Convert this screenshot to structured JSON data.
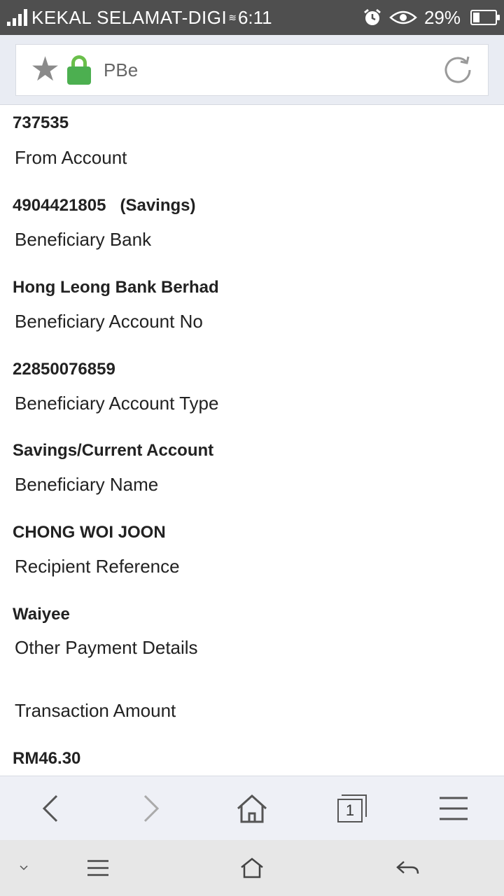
{
  "status_bar": {
    "carrier": "KEKAL SELAMAT-DIGI",
    "time": "6:11",
    "battery": "29%",
    "battery_level": 0.29,
    "icons": [
      "signal-icon",
      "wifi-icon",
      "alarm-icon",
      "eye-icon",
      "battery-icon"
    ]
  },
  "address_bar": {
    "site_title": "PBe",
    "icons": [
      "star-icon",
      "lock-icon",
      "reload-icon"
    ]
  },
  "transfer_details": {
    "reference_value": "737535",
    "from_account_label": "From Account",
    "from_account_value": "4904421805   (Savings)",
    "beneficiary_bank_label": "Beneficiary Bank",
    "beneficiary_bank_value": "Hong Leong Bank Berhad",
    "beneficiary_account_no_label": "Beneficiary Account No",
    "beneficiary_account_no_value": "22850076859",
    "beneficiary_account_type_label": "Beneficiary Account Type",
    "beneficiary_account_type_value": "Savings/Current Account",
    "beneficiary_name_label": "Beneficiary Name",
    "beneficiary_name_value": "CHONG WOI JOON",
    "recipient_reference_label": "Recipient Reference",
    "recipient_reference_value": "Waiyee",
    "other_payment_details_label": "Other Payment Details",
    "other_payment_details_value": "",
    "transaction_amount_label": "Transaction Amount",
    "transaction_amount_value": "RM46.30"
  },
  "browser_nav": {
    "tab_count": "1",
    "icons": [
      "back-icon",
      "forward-icon",
      "home-icon",
      "tabs-icon",
      "menu-icon"
    ]
  },
  "system_nav": {
    "icons": [
      "chevron-down-icon",
      "menu-icon",
      "home-icon",
      "back-icon"
    ]
  },
  "colors": {
    "status_bar_bg": "#4f4f4f",
    "address_area_bg": "#e9ecf3",
    "lock_green": "#4caf50",
    "browser_nav_bg": "#eef0f6",
    "system_nav_bg": "#e7e7e7"
  }
}
